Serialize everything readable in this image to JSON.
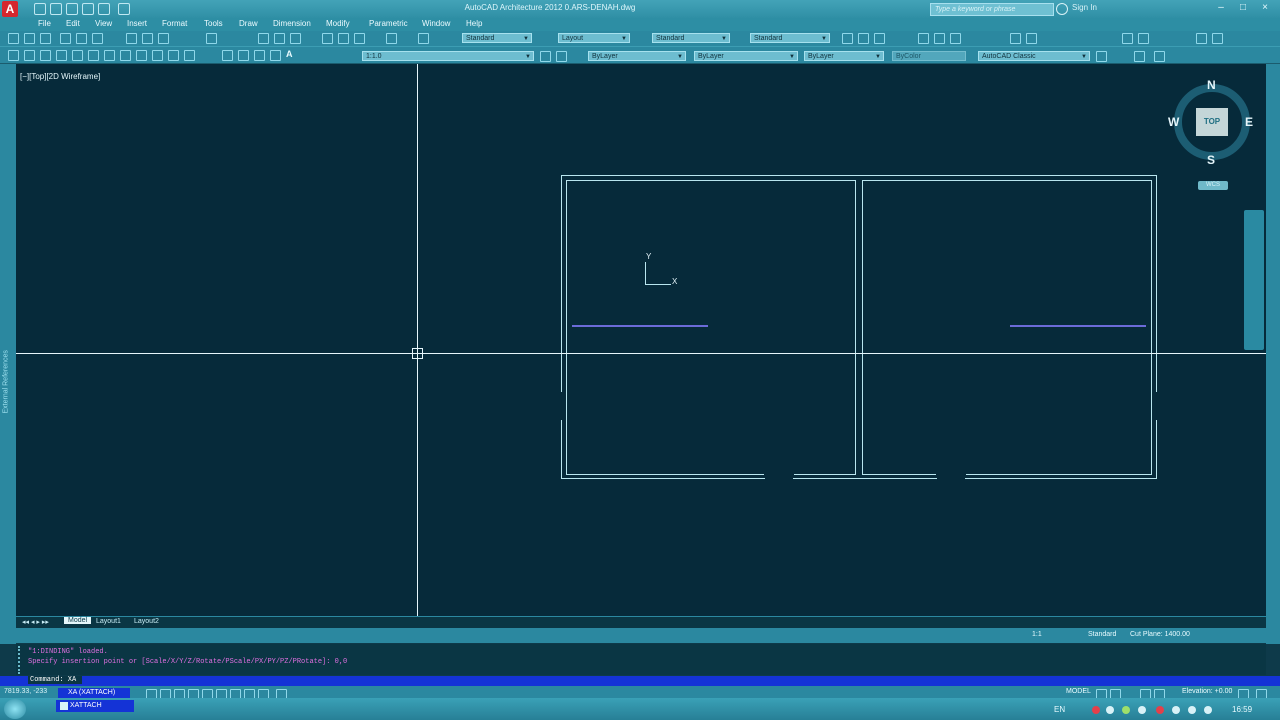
{
  "window": {
    "title": "AutoCAD Architecture 2012   0.ARS-DENAH.dwg",
    "search_placeholder": "Type a keyword or phrase",
    "signin": "Sign In"
  },
  "menu": [
    "File",
    "Edit",
    "View",
    "Insert",
    "Format",
    "Tools",
    "Draw",
    "Dimension",
    "Modify",
    "Parametric",
    "Window",
    "Help"
  ],
  "toolbar": {
    "text_style": "Standard",
    "layout": "Layout",
    "dim_style": "Standard",
    "table_style": "Standard",
    "scale": "1:1.0",
    "layer": "ByLayer",
    "linetype": "ByLayer",
    "lineweight": "ByLayer",
    "color": "ByColor",
    "workspace": "AutoCAD Classic"
  },
  "viewport": {
    "label": "[−][Top][2D Wireframe]",
    "left_strip": "External References"
  },
  "viewcube": {
    "north": "N",
    "south": "S",
    "east": "E",
    "west": "W",
    "face": "TOP",
    "wcs": "WCS"
  },
  "ucs": {
    "x": "X",
    "y": "Y"
  },
  "tabs": [
    "Model",
    "Layout1",
    "Layout2"
  ],
  "status_right": {
    "scale": "1:1",
    "style": "Standard",
    "cutplane": "Cut Plane:  1400.00"
  },
  "command": {
    "line1": "\"1:DINDING\" loaded.",
    "line2": "Specify insertion point or [Scale/X/Y/Z/Rotate/PScale/PX/PY/PZ/PRotate]: 0,0",
    "prompt": "Command: XA",
    "autocomplete": "XA (XATTACH)"
  },
  "statusbar": {
    "coords": "7819.33, -233",
    "model": "MODEL",
    "elevation": "Elevation: +0.00"
  },
  "taskbar": {
    "item": "XATTACH",
    "lang": "EN",
    "clock": "16:59"
  }
}
